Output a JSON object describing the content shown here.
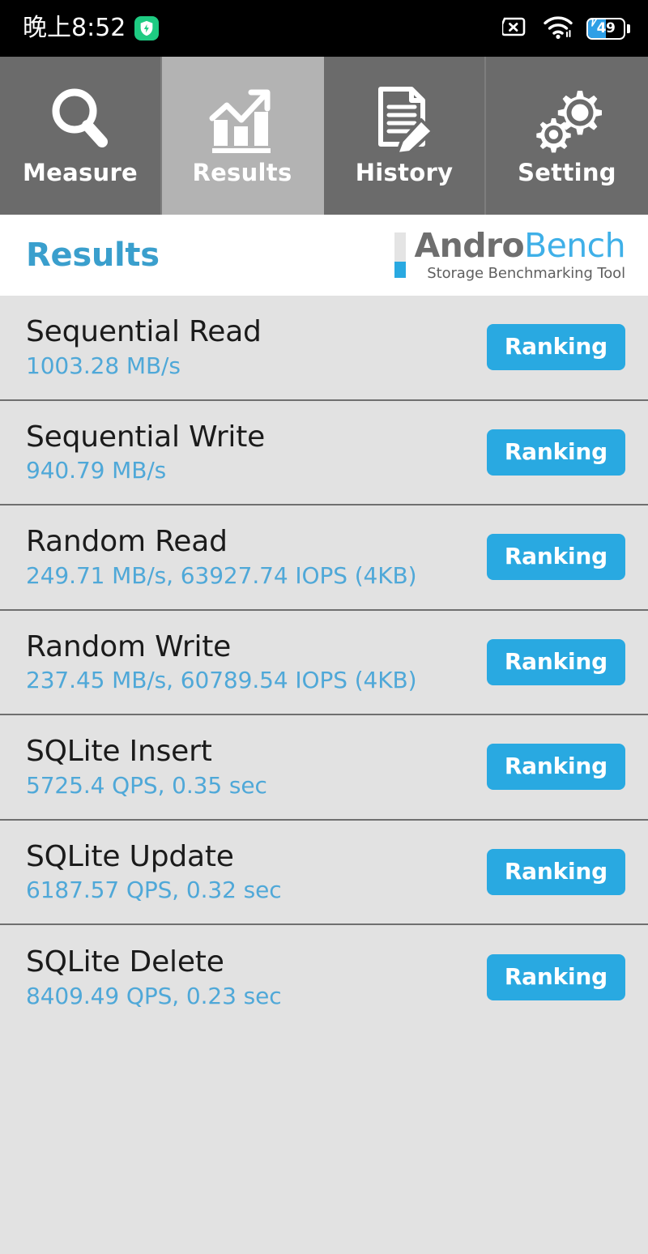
{
  "status_bar": {
    "time": "晚上8:52",
    "shield_icon": "security-shield-icon",
    "sim_icon": "sim-card-off-icon",
    "wifi_icon": "wifi-icon",
    "battery_icon": "battery-charging-icon",
    "battery_percent": "49"
  },
  "tabs": [
    {
      "label": "Measure",
      "icon": "magnifier-icon",
      "active": false
    },
    {
      "label": "Results",
      "icon": "bar-chart-icon",
      "active": true
    },
    {
      "label": "History",
      "icon": "document-pen-icon",
      "active": false
    },
    {
      "label": "Setting",
      "icon": "gears-icon",
      "active": false
    }
  ],
  "header": {
    "title": "Results",
    "brand_primary": "Andro",
    "brand_secondary": "Bench",
    "brand_subtitle": "Storage Benchmarking Tool"
  },
  "ranking_label": "Ranking",
  "results": [
    {
      "name": "Sequential Read",
      "value": "1003.28 MB/s",
      "button": "Ranking"
    },
    {
      "name": "Sequential Write",
      "value": "940.79 MB/s",
      "button": "Ranking"
    },
    {
      "name": "Random Read",
      "value": "249.71 MB/s, 63927.74 IOPS (4KB)",
      "button": "Ranking"
    },
    {
      "name": "Random Write",
      "value": "237.45 MB/s, 60789.54 IOPS (4KB)",
      "button": "Ranking"
    },
    {
      "name": "SQLite Insert",
      "value": "5725.4 QPS, 0.35 sec",
      "button": "Ranking"
    },
    {
      "name": "SQLite Update",
      "value": "6187.57 QPS, 0.32 sec",
      "button": "Ranking"
    },
    {
      "name": "SQLite Delete",
      "value": "8409.49 QPS, 0.23 sec",
      "button": "Ranking"
    }
  ],
  "colors": {
    "accent_blue": "#29a9e1",
    "value_blue": "#4fa8d8",
    "title_blue": "#3a9fcd",
    "tab_inactive": "#6b6b6b",
    "tab_active": "#b3b3b3",
    "row_bg": "#e2e2e2",
    "status_bg": "#000000"
  }
}
